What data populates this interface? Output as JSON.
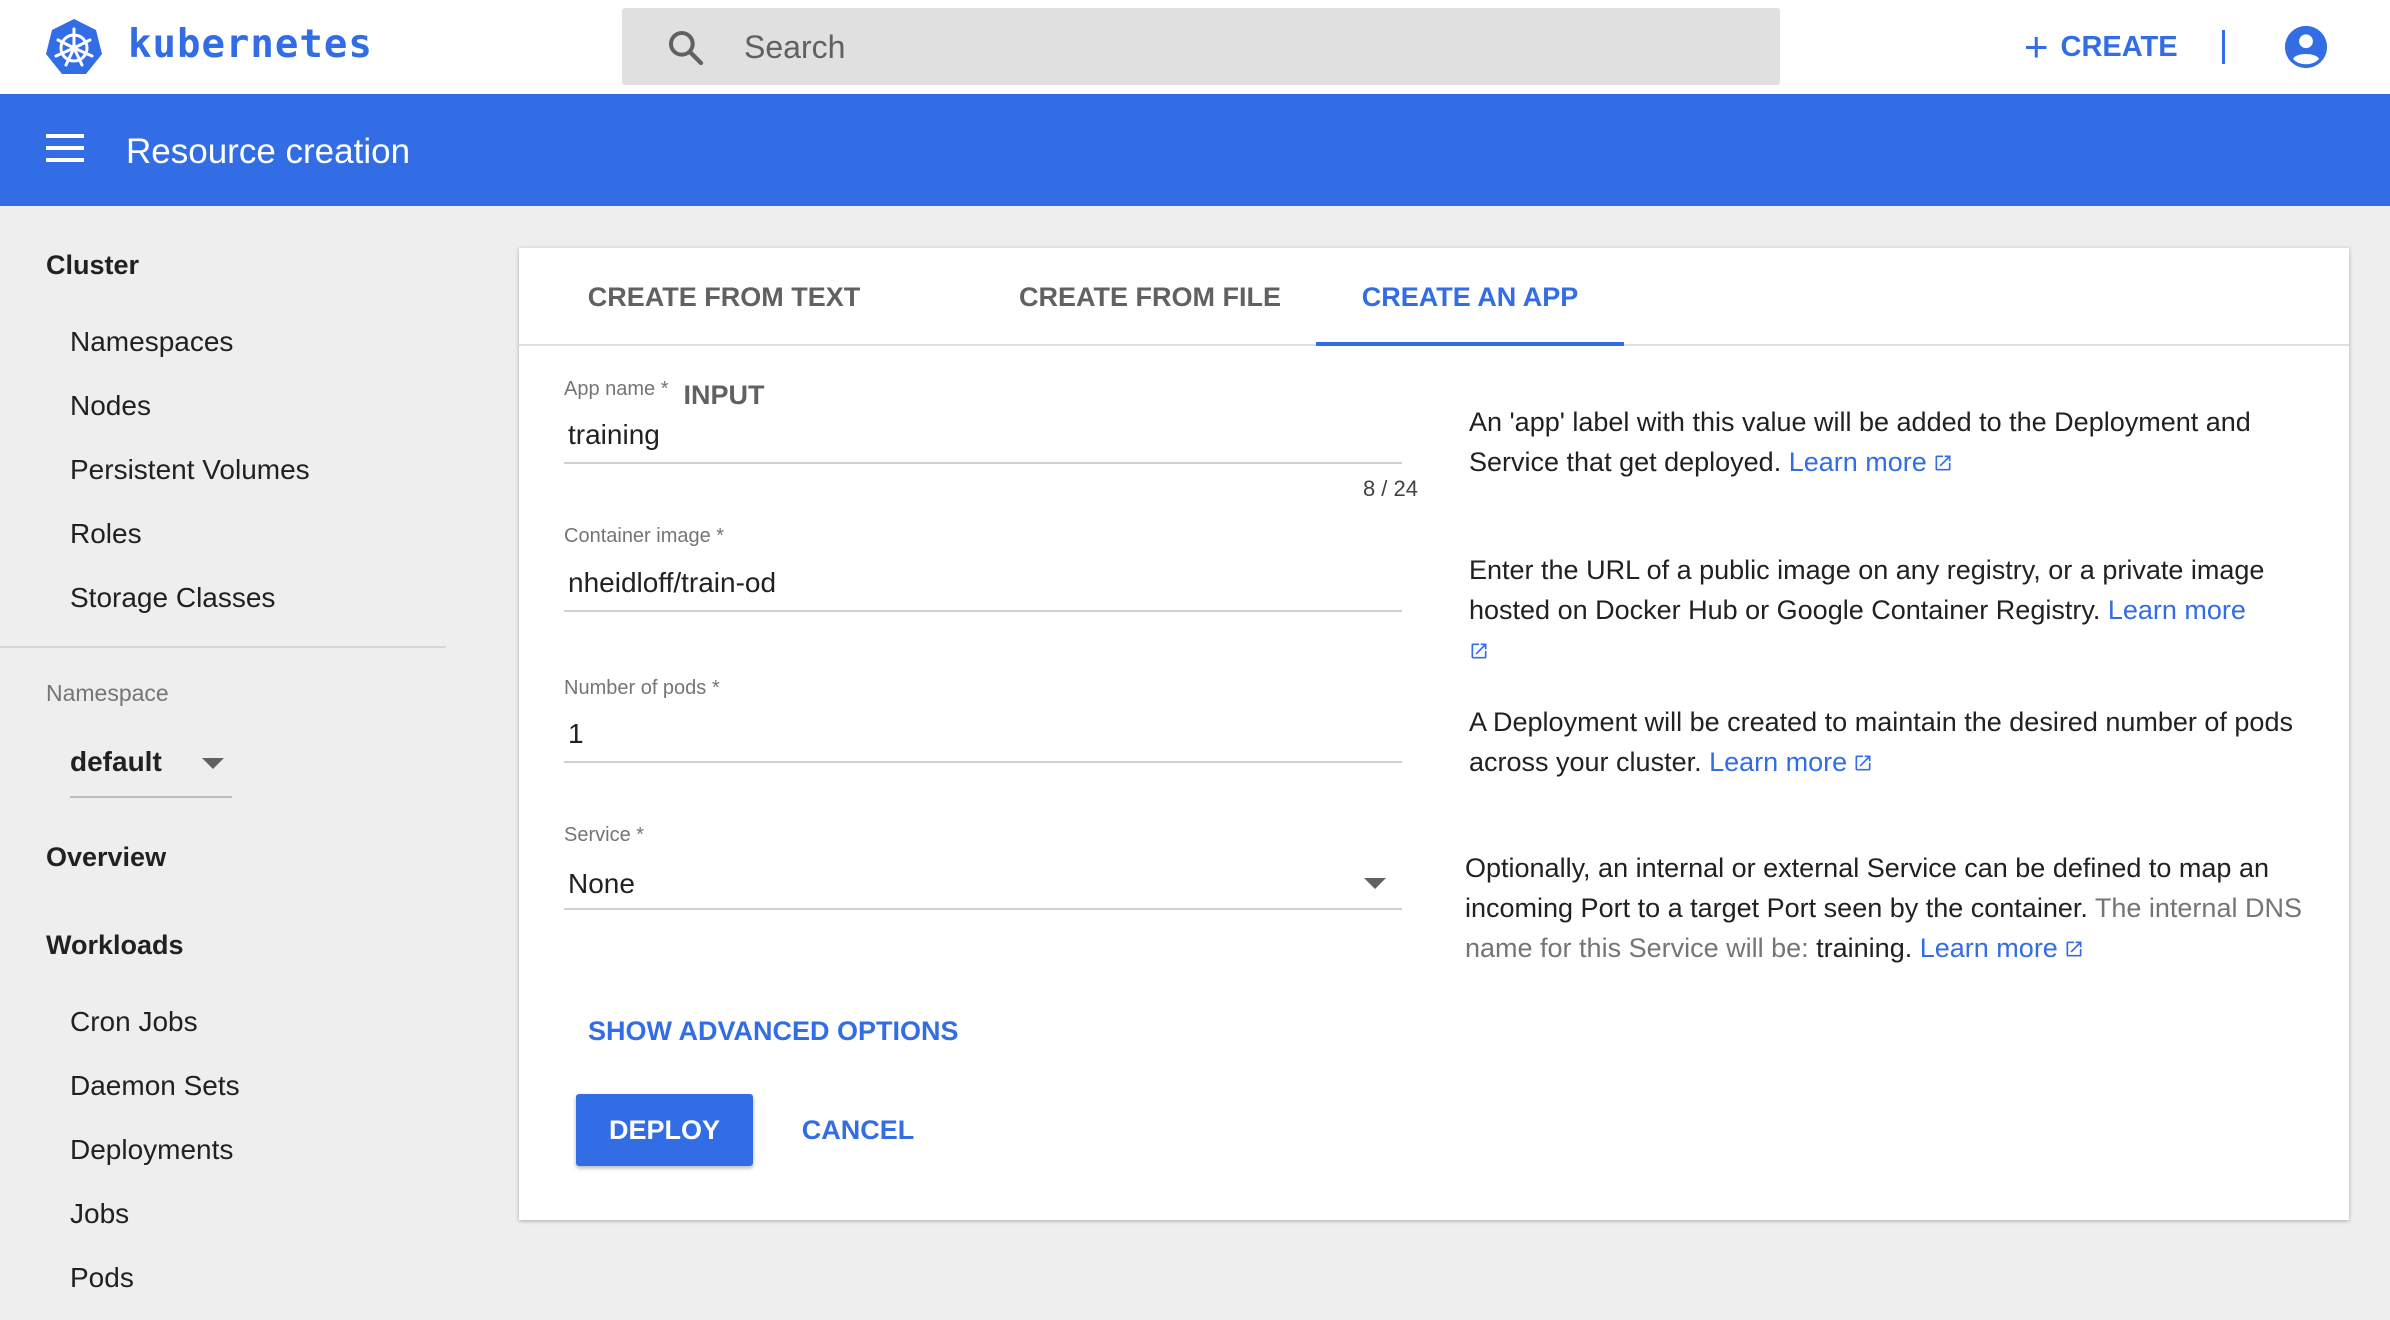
{
  "header": {
    "brand": "kubernetes",
    "search_placeholder": "Search",
    "create_label": "CREATE"
  },
  "appbar": {
    "title": "Resource creation"
  },
  "sidebar": {
    "cluster_heading": "Cluster",
    "cluster_items": [
      "Namespaces",
      "Nodes",
      "Persistent Volumes",
      "Roles",
      "Storage Classes"
    ],
    "namespace_label": "Namespace",
    "namespace_value": "default",
    "overview_heading": "Overview",
    "workloads_heading": "Workloads",
    "workload_items": [
      "Cron Jobs",
      "Daemon Sets",
      "Deployments",
      "Jobs",
      "Pods"
    ]
  },
  "tabs": [
    {
      "label": "CREATE FROM TEXT INPUT",
      "active": false
    },
    {
      "label": "CREATE FROM FILE",
      "active": false
    },
    {
      "label": "CREATE AN APP",
      "active": true
    }
  ],
  "form": {
    "app_name_label": "App name *",
    "app_name_value": "training",
    "app_name_counter": "8 / 24",
    "container_image_label": "Container image *",
    "container_image_value": "nheidloff/train-od",
    "pods_label": "Number of pods *",
    "pods_value": "1",
    "service_label": "Service *",
    "service_value": "None",
    "advanced_label": "SHOW ADVANCED OPTIONS",
    "deploy_label": "DEPLOY",
    "cancel_label": "CANCEL"
  },
  "help": {
    "app_name": "An 'app' label with this value will be added to the Deployment and Service that get deployed.",
    "container_image": "Enter the URL of a public image on any registry, or a private image hosted on Docker Hub or Google Container Registry.",
    "pods": "A Deployment will be created to maintain the desired number of pods across your cluster.",
    "service": "Optionally, an internal or external Service can be defined to map an incoming Port to a target Port seen by the container.",
    "service_dns_prefix": "The internal DNS name for this Service will be:",
    "service_dns_name": "training",
    "learn_more": "Learn more"
  },
  "colors": {
    "accent": "#326de6",
    "background": "#eeeeee"
  }
}
